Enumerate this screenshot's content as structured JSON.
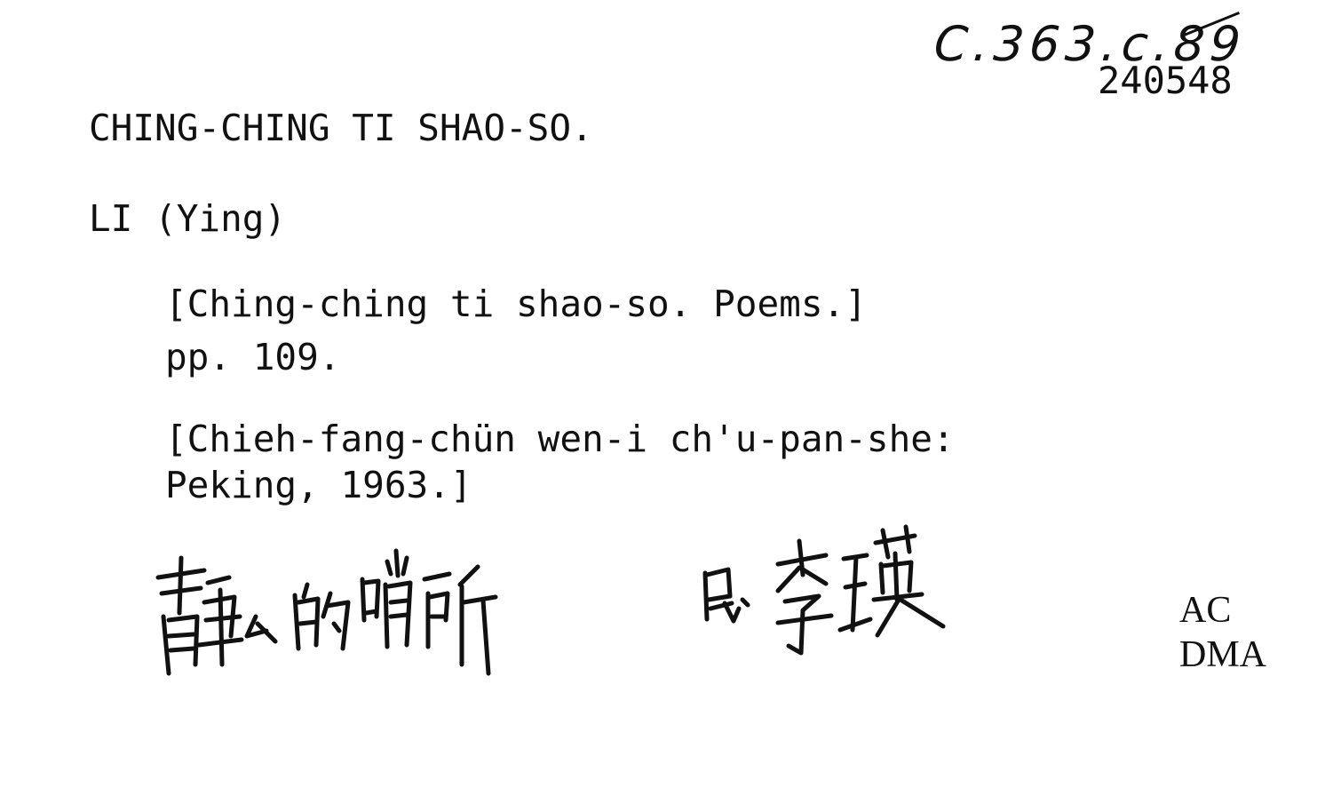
{
  "card": {
    "shelfmark": "C.363.c.89",
    "accession": "240548",
    "heading": "CHING-CHING TI SHAO-SO.",
    "author": "LI (Ying)",
    "title_line": "[Ching-ching ti shao-so. Poems.]",
    "pages": "pp. 109.",
    "imprint_line1": "[Chieh-fang-chün wen-i ch'u-pan-she:",
    "imprint_line2": "Peking, 1963.]",
    "handwritten_title": "静静的哨所",
    "handwritten_author": "民李瑛",
    "note_line1": "AC",
    "note_line2": "DMA"
  }
}
